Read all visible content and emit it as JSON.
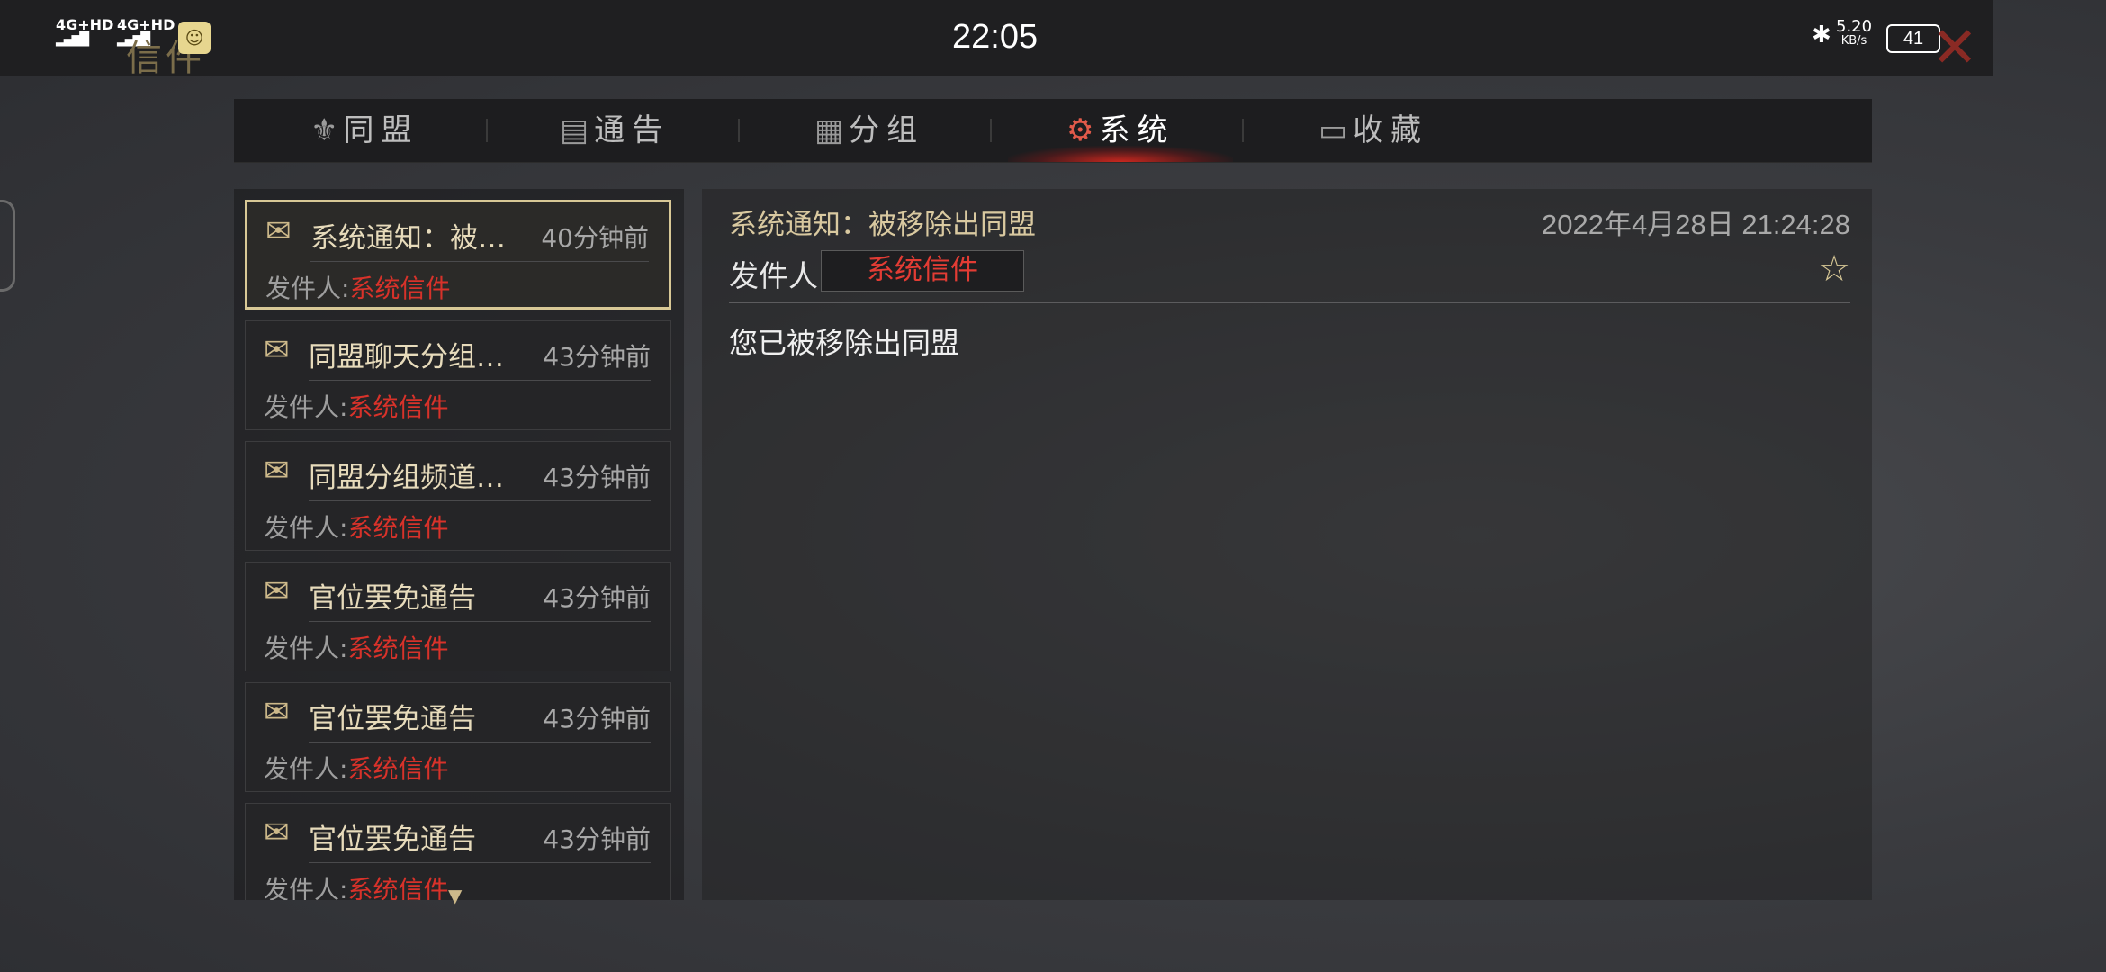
{
  "status_bar": {
    "signal1": "4G+HD",
    "signal2": "4G+HD",
    "time": "22:05",
    "net_speed": "5.20",
    "net_unit": "KB/s",
    "battery": "41"
  },
  "screen": {
    "title": "信件"
  },
  "tabs": [
    {
      "label": "同盟",
      "icon": "alliance-emblem-icon"
    },
    {
      "label": "通告",
      "icon": "notice-icon"
    },
    {
      "label": "分组",
      "icon": "group-icon"
    },
    {
      "label": "系统",
      "icon": "gear-icon",
      "active": true
    },
    {
      "label": "收藏",
      "icon": "chest-icon"
    }
  ],
  "mail_list": [
    {
      "subject": "系统通知：被移除出同盟",
      "time": "40分钟前",
      "from_label": "发件人:",
      "from": "系统信件",
      "selected": true
    },
    {
      "subject": "同盟聊天分组…",
      "time": "43分钟前",
      "from_label": "发件人:",
      "from": "系统信件"
    },
    {
      "subject": "同盟分组频道…",
      "time": "43分钟前",
      "from_label": "发件人:",
      "from": "系统信件"
    },
    {
      "subject": "官位罢免通告",
      "time": "43分钟前",
      "from_label": "发件人:",
      "from": "系统信件"
    },
    {
      "subject": "官位罢免通告",
      "time": "43分钟前",
      "from_label": "发件人:",
      "from": "系统信件"
    },
    {
      "subject": "官位罢免通告",
      "time": "43分钟前",
      "from_label": "发件人:",
      "from": "系统信件"
    }
  ],
  "detail": {
    "subject": "系统通知：被移除出同盟",
    "date": "2022年4月28日 21:24:28",
    "from_label": "发件人",
    "from": "系统信件",
    "body": "您已被移除出同盟"
  },
  "colors": {
    "accent_red": "#d8322a",
    "gold": "#d8c896",
    "tab_glow": "#e25a4a"
  }
}
